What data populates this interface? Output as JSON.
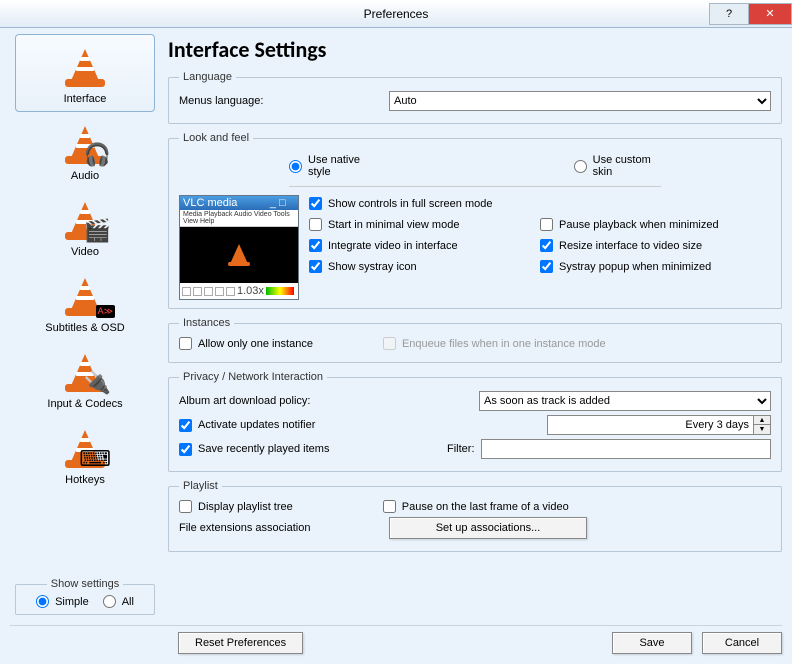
{
  "title": "Preferences",
  "sidebar": {
    "items": [
      {
        "label": "Interface",
        "acc": ""
      },
      {
        "label": "Audio",
        "acc": "🎧"
      },
      {
        "label": "Video",
        "acc": "🎬"
      },
      {
        "label": "Subtitles & OSD",
        "acc": ""
      },
      {
        "label": "Input & Codecs",
        "acc": "🔌"
      },
      {
        "label": "Hotkeys",
        "acc": "⌨"
      }
    ]
  },
  "show_settings": {
    "legend": "Show settings",
    "simple": "Simple",
    "all": "All"
  },
  "page": {
    "heading": "Interface Settings",
    "language": {
      "legend": "Language",
      "menus_label": "Menus language:",
      "value": "Auto"
    },
    "look": {
      "legend": "Look and feel",
      "native": "Use native style",
      "custom": "Use custom skin",
      "preview_title": "VLC media player",
      "preview_menu": "Media Playback Audio Video Tools View Help",
      "preview_time": "1.03x",
      "checks": {
        "fullscreen": "Show controls in full screen mode",
        "minimal": "Start in minimal view mode",
        "pausemin": "Pause playback when minimized",
        "integrate": "Integrate video in interface",
        "resize": "Resize interface to video size",
        "systray": "Show systray icon",
        "popup": "Systray popup when minimized"
      }
    },
    "instances": {
      "legend": "Instances",
      "one": "Allow only one instance",
      "enqueue": "Enqueue files when in one instance mode"
    },
    "privacy": {
      "legend": "Privacy / Network Interaction",
      "album_label": "Album art download policy:",
      "album_value": "As soon as track is added",
      "updates": "Activate updates notifier",
      "updates_freq": "Every 3 days",
      "recent": "Save recently played items",
      "filter_label": "Filter:"
    },
    "playlist": {
      "legend": "Playlist",
      "tree": "Display playlist tree",
      "pauselast": "Pause on the last frame of a video",
      "ext_label": "File extensions association",
      "ext_btn": "Set up associations..."
    }
  },
  "footer": {
    "reset": "Reset Preferences",
    "save": "Save",
    "cancel": "Cancel"
  }
}
